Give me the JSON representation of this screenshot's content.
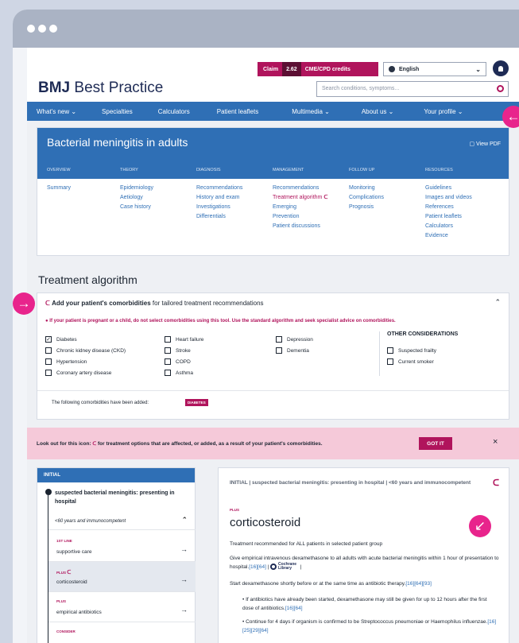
{
  "header": {
    "claim_label": "Claim",
    "claim_value": "2.62",
    "claim_unit": "CME/CPD credits",
    "language": "English",
    "logo_bold": "BMJ",
    "logo_rest": "Best Practice",
    "search_placeholder": "Search conditions, symptoms..."
  },
  "nav": {
    "items": [
      "What's new ⌄",
      "Specialties",
      "Calculators",
      "Patient leaflets",
      "Multimedia ⌄",
      "About us ⌄",
      "Your profile ⌄"
    ]
  },
  "topic": {
    "title": "Bacterial meningitis in adults",
    "view_pdf": "View PDF",
    "categories": [
      "OVERVIEW",
      "THEORY",
      "DIAGNOSIS",
      "MANAGEMENT",
      "FOLLOW UP",
      "RESOURCES"
    ],
    "overview": [
      "Summary"
    ],
    "theory": [
      "Epidemiology",
      "Aetiology",
      "Case history"
    ],
    "diagnosis": [
      "Recommendations",
      "History and exam",
      "Investigations",
      "Differentials"
    ],
    "management": [
      "Recommendations",
      "Treatment algorithm",
      "Emerging",
      "Prevention",
      "Patient discussions"
    ],
    "followup": [
      "Monitoring",
      "Complications",
      "Prognosis"
    ],
    "resources": [
      "Guidelines",
      "Images and videos",
      "References",
      "Patient leaflets",
      "Calculators",
      "Evidence"
    ]
  },
  "section_title": "Treatment algorithm",
  "comorbidities": {
    "heading_bold": "Add your patient's comorbidities",
    "heading_rest": "for tailored treatment recommendations",
    "warning": "If your patient is pregnant or a child, do not select comorbidities using this tool. Use the standard algorithm and seek specialist advice on comorbidities.",
    "col1": [
      "Diabetes",
      "Chronic kidney disease (CKD)",
      "Hypertension",
      "Coronary artery disease"
    ],
    "col2": [
      "Heart failure",
      "Stroke",
      "COPD",
      "Asthma"
    ],
    "col3": [
      "Depression",
      "Dementia"
    ],
    "other_title": "OTHER CONSIDERATIONS",
    "other": [
      "Suspected frailty",
      "Current smoker"
    ],
    "added_text": "The following comorbidities have been added:",
    "added_badge": "DIABETES"
  },
  "banner": {
    "text_a": "Look out for this icon:",
    "text_b": "for treatment options that are affected, or added, as a result of your patient's comorbidities.",
    "button": "GOT IT",
    "close": "×"
  },
  "sidebar": {
    "tab": "INITIAL",
    "group_title": "suspected bacterial meningitis: presenting in hospital",
    "subgroup": "<60 years and immunocompetent",
    "options": [
      {
        "label": "1ST LINE",
        "name": "supportive care"
      },
      {
        "label": "PLUS",
        "name": "corticosteroid"
      },
      {
        "label": "PLUS",
        "name": "empirical antibiotics"
      },
      {
        "label": "CONSIDER",
        "name": ""
      }
    ]
  },
  "detail": {
    "heading": "INITIAL | suspected bacterial meningitis: presenting in hospital | <60 years and immunocompetent",
    "plus": "PLUS",
    "title": "corticosteroid",
    "p1": "Treatment recommended for ALL patients in selected patient group",
    "p2": "Give empirical intravenous dexamethasone to all adults with acute bacterial meningitis within 1 hour of presentation to hospital.",
    "p2_refs": "[16][64]",
    "cochrane": "Cochrane Library",
    "p3": "Start dexamethasone shortly before or at the same time as antibiotic therapy.",
    "p3_refs": "[16][64][93]",
    "b1": "If antibiotics have already been started, dexamethasone may still be given for up to 12 hours after the first dose of antibiotics.",
    "b1_refs": "[16][64]",
    "b2": "Continue for 4 days if organism is confirmed to be Streptococcus pneumoniae or Haemophilus influenzae.",
    "b2_refs": "[16][25][29][64]"
  },
  "colors": {
    "accent": "#b0145c",
    "primary": "#2f6fb5",
    "navy": "#1e2b55",
    "pointer": "#e8248c"
  }
}
